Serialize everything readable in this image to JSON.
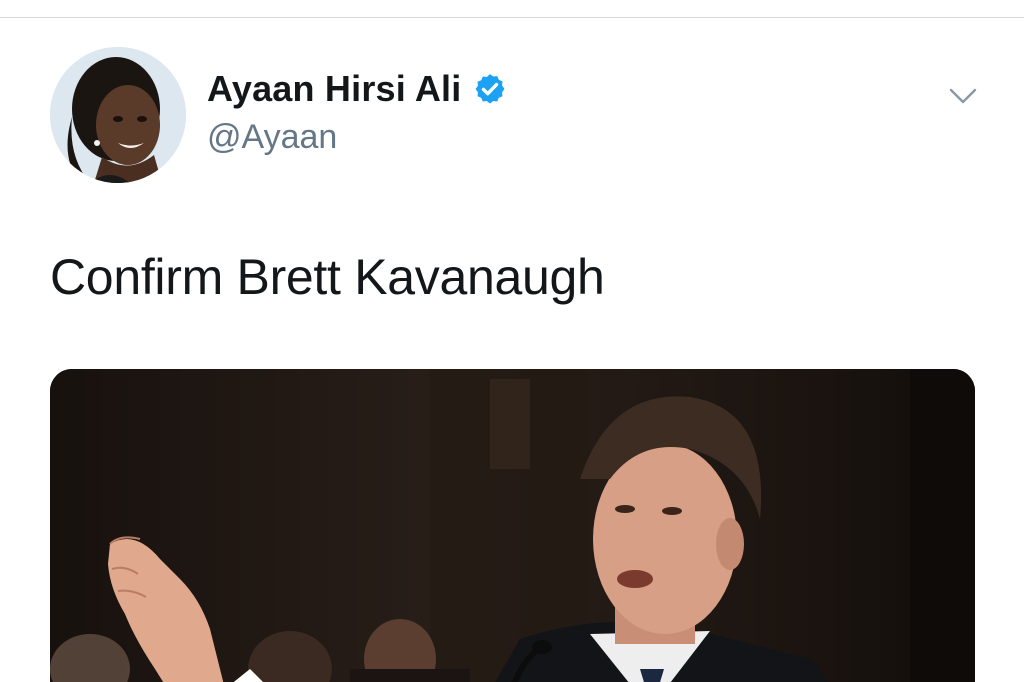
{
  "tweet": {
    "author": {
      "display_name": "Ayaan Hirsi Ali",
      "handle": "@Ayaan",
      "verified": true
    },
    "text": "Confirm Brett Kavanaugh",
    "icons": {
      "verified": "verified-badge-icon",
      "caret": "chevron-down-icon"
    },
    "colors": {
      "verified_blue": "#1da1f2",
      "name": "#14171a",
      "handle": "#657786",
      "divider": "#d9d9d9"
    }
  }
}
